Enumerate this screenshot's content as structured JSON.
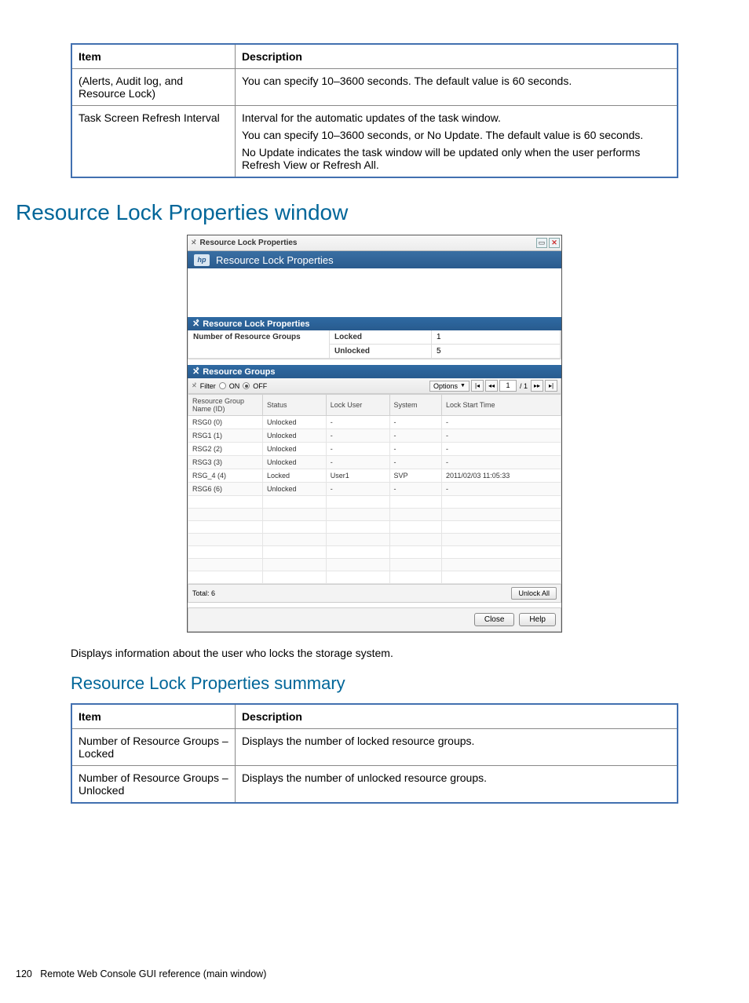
{
  "table1": {
    "headers": {
      "item": "Item",
      "desc": "Description"
    },
    "rows": [
      {
        "item": "(Alerts, Audit log, and Resource Lock)",
        "desc": "You can specify 10–3600 seconds. The default value is 60 seconds."
      },
      {
        "item": "Task Screen Refresh Interval",
        "desc_line1": "Interval for the automatic updates of the task window.",
        "desc_line2a": "You can specify 10–3600 seconds, or ",
        "desc_line2b_bold": "No Update",
        "desc_line2c": ". The default value is 60 seconds.",
        "desc_line3a_bold": "No Update",
        "desc_line3b": " indicates the task window will be updated only when the user performs ",
        "desc_line3c_bold": "Refresh View",
        "desc_line3d": " or ",
        "desc_line3e_bold": "Refresh All",
        "desc_line3f": "."
      }
    ]
  },
  "heading1": "Resource Lock Properties window",
  "screenshot": {
    "titlebar": {
      "title": "Resource Lock Properties"
    },
    "banner": {
      "hp_label": "hp",
      "title": "Resource Lock Properties"
    },
    "summary_panel": {
      "header": "Resource Lock Properties",
      "row_label": "Number of Resource Groups",
      "locked_label": "Locked",
      "locked_value": "1",
      "unlocked_label": "Unlocked",
      "unlocked_value": "5"
    },
    "groups_panel": {
      "header": "Resource Groups",
      "filter_label": "Filter",
      "on_label": "ON",
      "off_label": "OFF",
      "options_label": "Options",
      "page_current": "1",
      "page_total": "/ 1",
      "columns": {
        "c0": "Resource Group Name (ID)",
        "c1": "Status",
        "c2": "Lock User",
        "c3": "System",
        "c4": "Lock Start Time"
      },
      "rows": [
        {
          "c0": "RSG0 (0)",
          "c1": "Unlocked",
          "c2": "-",
          "c3": "-",
          "c4": "-"
        },
        {
          "c0": "RSG1 (1)",
          "c1": "Unlocked",
          "c2": "-",
          "c3": "-",
          "c4": "-"
        },
        {
          "c0": "RSG2 (2)",
          "c1": "Unlocked",
          "c2": "-",
          "c3": "-",
          "c4": "-"
        },
        {
          "c0": "RSG3 (3)",
          "c1": "Unlocked",
          "c2": "-",
          "c3": "-",
          "c4": "-"
        },
        {
          "c0": "RSG_4 (4)",
          "c1": "Locked",
          "c2": "User1",
          "c3": "SVP",
          "c4": "2011/02/03 11:05:33"
        },
        {
          "c0": "RSG6 (6)",
          "c1": "Unlocked",
          "c2": "-",
          "c3": "-",
          "c4": "-"
        }
      ],
      "total_label": "Total: 6",
      "unlock_all_label": "Unlock All"
    },
    "footer_buttons": {
      "close": "Close",
      "help": "Help"
    }
  },
  "body_text": "Displays information about the user who locks the storage system.",
  "heading2": "Resource Lock Properties summary",
  "table2": {
    "headers": {
      "item": "Item",
      "desc": "Description"
    },
    "rows": [
      {
        "item": "Number of Resource Groups – Locked",
        "desc": "Displays the number of locked resource groups."
      },
      {
        "item": "Number of Resource Groups – Unlocked",
        "desc": "Displays the number of unlocked resource groups."
      }
    ]
  },
  "footer": {
    "page": "120",
    "text": "Remote Web Console GUI reference (main window)"
  }
}
